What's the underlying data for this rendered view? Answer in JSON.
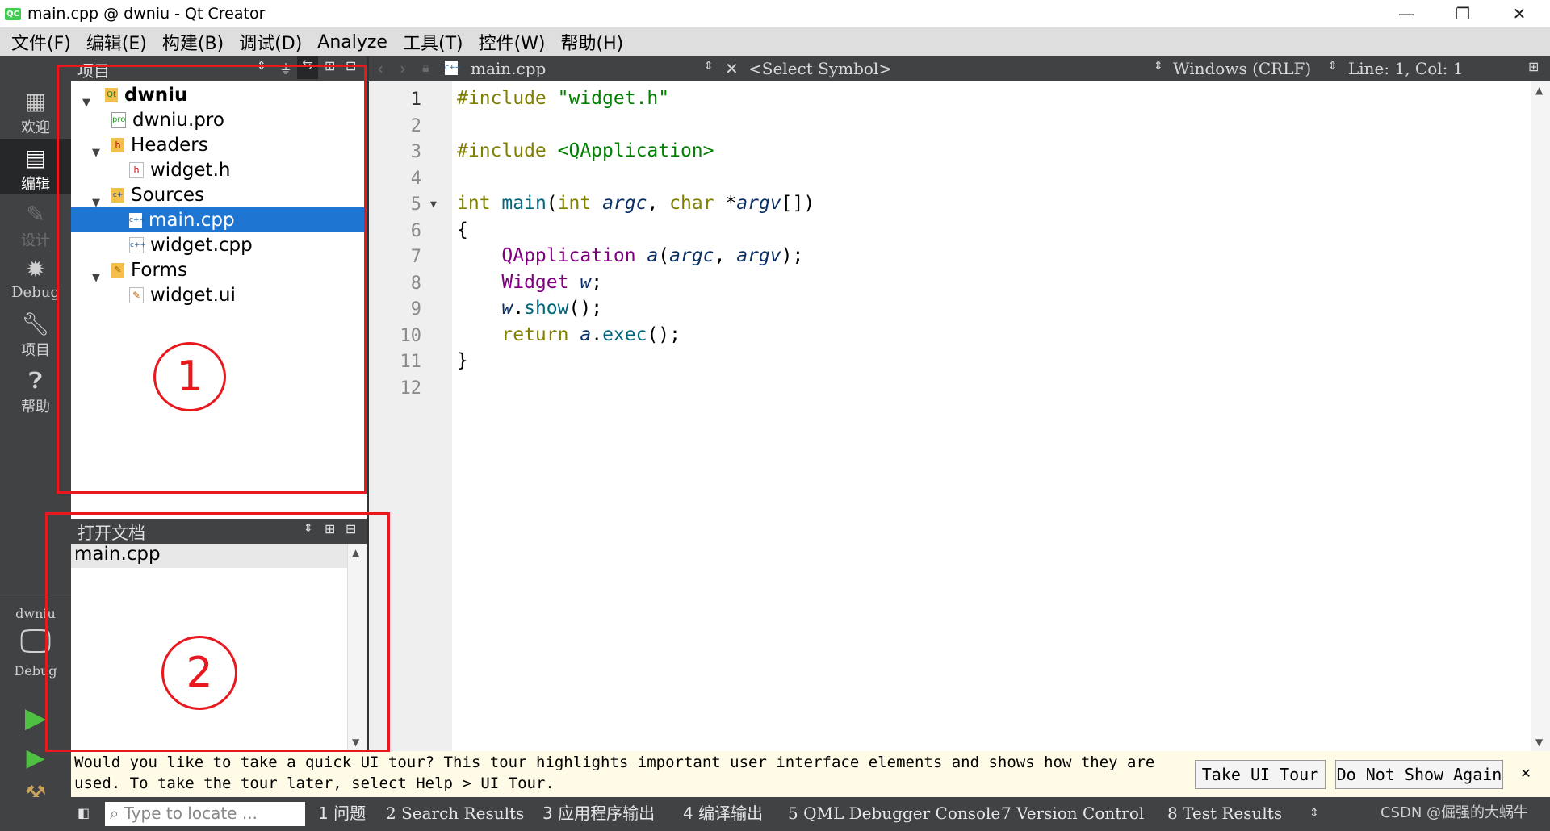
{
  "window": {
    "title": "main.cpp @ dwniu - Qt Creator",
    "controls": [
      "—",
      "❐",
      "✕"
    ]
  },
  "menu": [
    "文件(F)",
    "编辑(E)",
    "构建(B)",
    "调试(D)",
    "Analyze",
    "工具(T)",
    "控件(W)",
    "帮助(H)"
  ],
  "modes": [
    {
      "label": "欢迎",
      "icon": "grid-icon"
    },
    {
      "label": "编辑",
      "icon": "edit-icon"
    },
    {
      "label": "设计",
      "icon": "pencil-icon"
    },
    {
      "label": "Debug",
      "icon": "bug-icon"
    },
    {
      "label": "项目",
      "icon": "wrench-icon"
    },
    {
      "label": "帮助",
      "icon": "help-icon"
    }
  ],
  "kit": {
    "project": "dwniu",
    "config": "Debug"
  },
  "project_panel": {
    "title": "项目",
    "tree": [
      {
        "label": "dwniu",
        "level": 0,
        "expanded": true,
        "kind": "project"
      },
      {
        "label": "dwniu.pro",
        "level": 1,
        "kind": "pro"
      },
      {
        "label": "Headers",
        "level": 1,
        "expanded": true,
        "kind": "folder-h"
      },
      {
        "label": "widget.h",
        "level": 2,
        "kind": "h"
      },
      {
        "label": "Sources",
        "level": 1,
        "expanded": true,
        "kind": "folder-cpp"
      },
      {
        "label": "main.cpp",
        "level": 2,
        "kind": "cpp",
        "selected": true
      },
      {
        "label": "widget.cpp",
        "level": 2,
        "kind": "cpp"
      },
      {
        "label": "Forms",
        "level": 1,
        "expanded": true,
        "kind": "folder-ui"
      },
      {
        "label": "widget.ui",
        "level": 2,
        "kind": "ui"
      }
    ]
  },
  "open_docs": {
    "title": "打开文档",
    "items": [
      "main.cpp"
    ]
  },
  "editor": {
    "filename": "main.cpp",
    "symbol": "<Select Symbol>",
    "line_ending": "Windows (CRLF)",
    "position": "Line: 1, Col: 1",
    "line_numbers": [
      "1",
      "2",
      "3",
      "4",
      "5",
      "6",
      "7",
      "8",
      "9",
      "10",
      "11",
      "12"
    ]
  },
  "infobar": {
    "line1": "Would you like to take a quick UI tour? This tour highlights important user interface elements and shows how they are",
    "line2": "used. To take the tour later, select Help > UI Tour.",
    "take_tour": "Take UI Tour",
    "dont_show": "Do Not Show Again",
    "close": "✕"
  },
  "statusbar": {
    "locate_placeholder": "Type to locate ...",
    "panes": [
      "1 问题",
      "2 Search Results",
      "3 应用程序输出",
      "4 编译输出",
      "5 QML Debugger Console",
      "7 Version Control",
      "8 Test Results"
    ],
    "watermark": "CSDN @倔强的大蜗牛"
  },
  "annotations": [
    "1",
    "2"
  ],
  "colors": {
    "selection": "#1e76d2",
    "dark_panel": "#404244",
    "annotation_red": "#e8181e"
  }
}
